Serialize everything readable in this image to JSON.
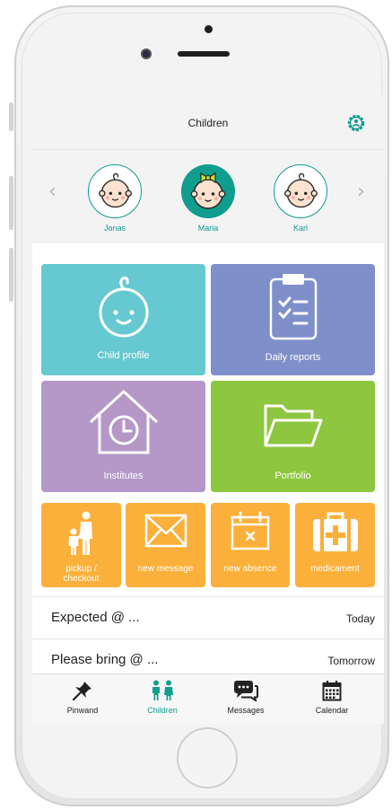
{
  "header": {
    "title": "Children"
  },
  "children": [
    {
      "name": "Jonas",
      "selected": false
    },
    {
      "name": "Maria",
      "selected": true
    },
    {
      "name": "Karl",
      "selected": false
    }
  ],
  "tiles": {
    "child_profile": "Child profile",
    "daily_reports": "Daily reports",
    "institutes": "Institutes",
    "portfolio": "Portfolio",
    "pickup_line1": "pickup /",
    "pickup_line2": "checkout",
    "new_message": "new message",
    "new_absence": "new absence",
    "medicament": "medicament"
  },
  "reminders": [
    {
      "label": "Expected @ ...",
      "when": "Today"
    },
    {
      "label": "Please bring @ ...",
      "when": "Tomorrow"
    }
  ],
  "tabs": [
    {
      "label": "Pinwand",
      "icon": "pin-icon"
    },
    {
      "label": "Children",
      "icon": "children-icon",
      "active": true
    },
    {
      "label": "Messages",
      "icon": "messages-icon"
    },
    {
      "label": "Calendar",
      "icon": "calendar-icon"
    }
  ],
  "colors": {
    "teal": "#0f9d8e",
    "cyan": "#66c9d1",
    "indigo": "#7f8fc9",
    "purple": "#b597c8",
    "green": "#8dc63f",
    "orange": "#fbb03b"
  }
}
